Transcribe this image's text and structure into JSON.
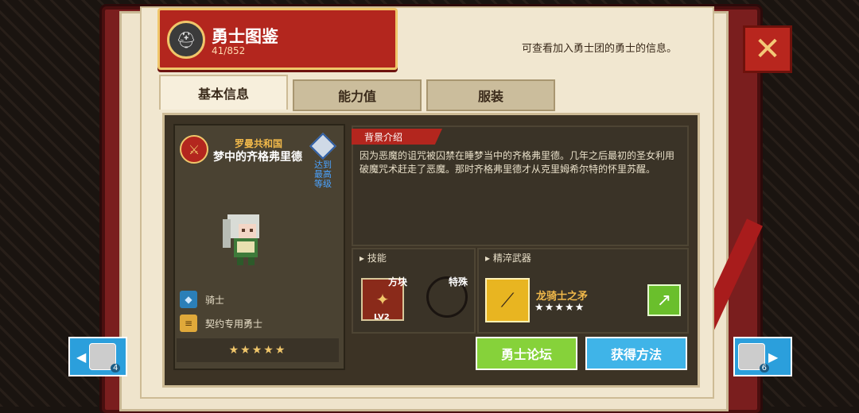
{
  "header": {
    "title": "勇士图鉴",
    "count": "41/852",
    "info": "可查看加入勇士团的勇士的信息。"
  },
  "tabs": [
    {
      "label": "基本信息",
      "active": true
    },
    {
      "label": "能力值",
      "active": false
    },
    {
      "label": "服装",
      "active": false
    }
  ],
  "character": {
    "faction": "罗曼共和国",
    "name": "梦中的齐格弗里德",
    "max_level_badge": "达到最高等级",
    "class_label": "骑士",
    "contract_label": "契约专用勇士",
    "stars": "★★★★★"
  },
  "background": {
    "label": "背景介绍",
    "text": "因为恶魔的诅咒被囚禁在睡梦当中的齐格弗里德。几年之后最初的圣女利用破魔咒术赶走了恶魔。那时齐格弗里德才从克里姆希尔特的怀里苏醒。"
  },
  "skills": {
    "label": "技能",
    "skill1_name": "方块",
    "skill1_level": "LV2",
    "skill2_name": "特殊"
  },
  "weapon": {
    "label": "精淬武器",
    "name": "龙骑士之矛",
    "stars": "★★★★★"
  },
  "buttons": {
    "forum": "勇士论坛",
    "obtain": "获得方法"
  },
  "nav": {
    "prev_num": "4",
    "next_num": "6"
  },
  "colors": {
    "accent_red": "#b3261e",
    "gold": "#f0c66a",
    "green": "#86d23a",
    "blue": "#2b9fdc"
  }
}
